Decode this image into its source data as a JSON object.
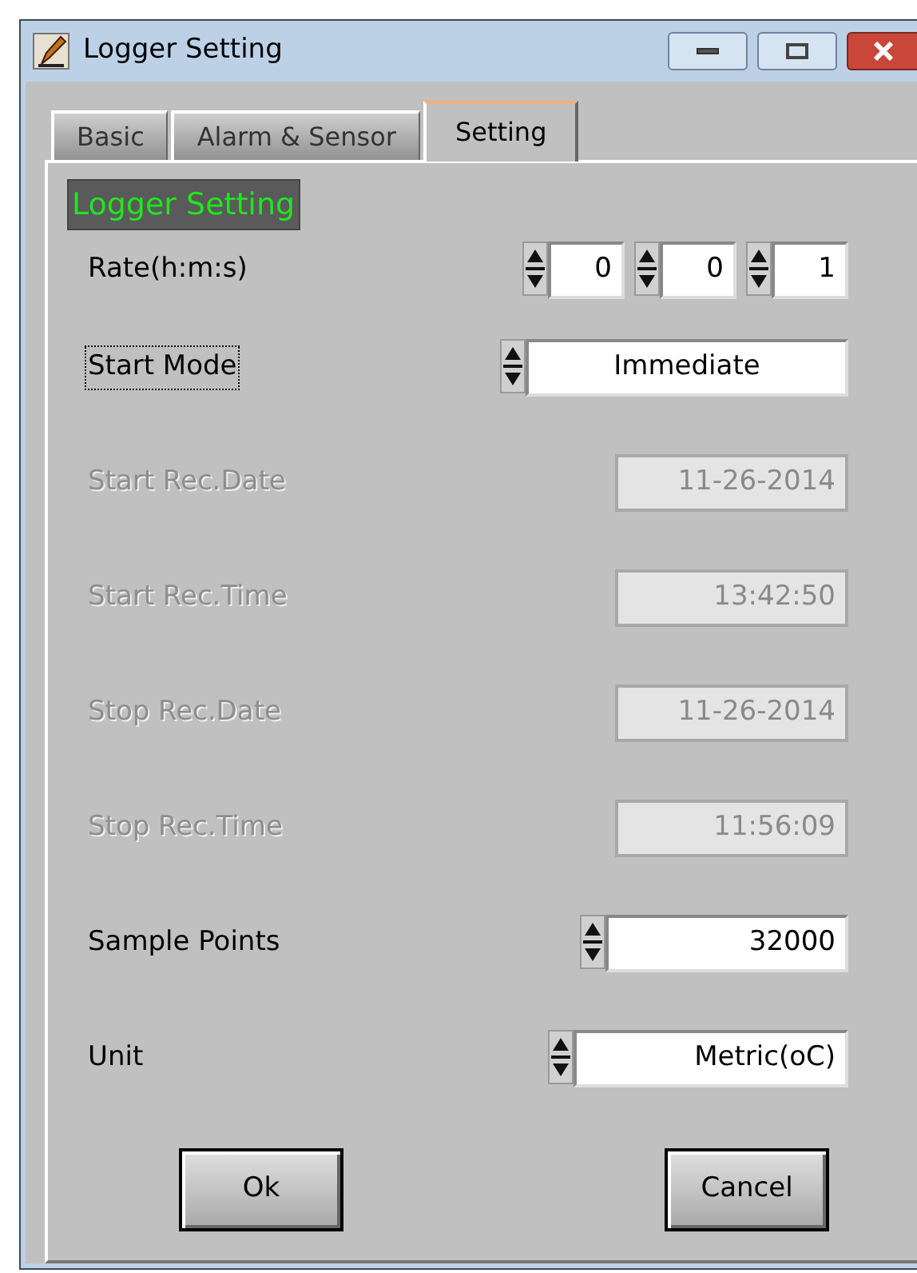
{
  "window": {
    "title": "Logger Setting"
  },
  "tabs": [
    {
      "label": "Basic",
      "selected": false
    },
    {
      "label": "Alarm & Sensor",
      "selected": false
    },
    {
      "label": "Setting",
      "selected": true
    }
  ],
  "section_label": "Logger Setting",
  "rows": [
    {
      "label": "Rate(h:m:s)",
      "kind": "multi",
      "disabled": false,
      "focused": false,
      "values": [
        "0",
        "0",
        "1"
      ]
    },
    {
      "label": "Start Mode",
      "kind": "ring",
      "disabled": false,
      "focused": true,
      "value": "Immediate"
    },
    {
      "label": "Start Rec.Date",
      "kind": "text",
      "disabled": true,
      "focused": false,
      "value": "11-26-2014"
    },
    {
      "label": "Start Rec.Time",
      "kind": "text",
      "disabled": true,
      "focused": false,
      "value": "13:42:50"
    },
    {
      "label": "Stop Rec.Date",
      "kind": "text",
      "disabled": true,
      "focused": false,
      "value": "11-26-2014"
    },
    {
      "label": "Stop Rec.Time",
      "kind": "text",
      "disabled": true,
      "focused": false,
      "value": "11:56:09"
    },
    {
      "label": "Sample Points",
      "kind": "numeric",
      "disabled": false,
      "focused": false,
      "value": "32000"
    },
    {
      "label": "Unit",
      "kind": "numeric",
      "disabled": false,
      "focused": false,
      "value": "Metric(oC)"
    }
  ],
  "buttons": [
    "Ok",
    "Cancel"
  ]
}
